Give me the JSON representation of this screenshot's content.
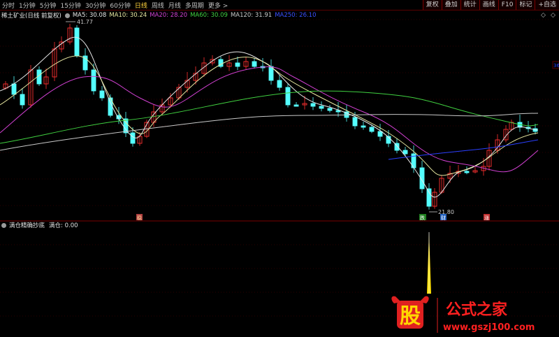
{
  "toolbar": {
    "periods": [
      "分时",
      "1分钟",
      "5分钟",
      "15分钟",
      "30分钟",
      "60分钟",
      "日线",
      "周线",
      "月线",
      "多周期",
      "更多 >"
    ],
    "active_period": "日线",
    "tools": [
      "复权",
      "叠加",
      "统计",
      "画线",
      "F10",
      "标记",
      "+自选"
    ]
  },
  "info": {
    "stock": "稀土矿业(日线 前复权)",
    "ma5": "MA5: 30.08",
    "ma10": "MA10: 30.24",
    "ma20": "MA20: 28.20",
    "ma60": "MA60: 30.09",
    "ma120": "MA120: 31.91",
    "ma250": "MA250: 26.10"
  },
  "colors": {
    "up": "#ff3030",
    "down": "#54ffff",
    "ma5": "#e6e6e6",
    "ma10": "#e6e6a0",
    "ma20": "#d040d0",
    "ma60": "#40d040",
    "ma120": "#c8c8c8",
    "ma250": "#2a40ff",
    "grid": "#5a0000",
    "signal": "#ffe000"
  },
  "annotations": {
    "high_label": "41.77",
    "low_label": "21.80",
    "price_axis": "36",
    "marker_1": "稳",
    "marker_2": "跌",
    "marker_3": "财",
    "marker_4": "涨"
  },
  "indicator": {
    "name": "满仓精确抄底",
    "value_label": "满仓: 0.00"
  },
  "watermark": {
    "logo_text": "股",
    "brand": "公式之家",
    "url": "www.gszj100.com"
  }
}
